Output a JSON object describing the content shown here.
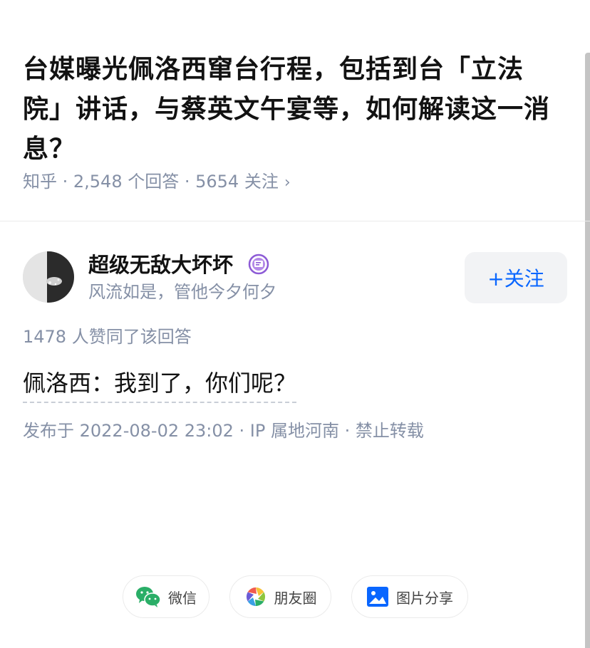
{
  "question": {
    "title": "台媒曝光佩洛西窜台行程，包括到台「立法院」讲话，与蔡英文午宴等，如何解读这一消息？",
    "source": "知乎",
    "answers_count": "2,548 个回答",
    "followers_count": "5654 关注",
    "separator": " · ",
    "chevron": "›"
  },
  "author": {
    "name": "超级无敌大坏坏",
    "bio": "风流如是，管他今夕何夕",
    "follow_label": "+关注"
  },
  "answer": {
    "votes": "1478 人赞同了该回答",
    "content": "佩洛西：我到了，你们呢？",
    "published": "发布于 2022-08-02 23:02 · IP 属地河南 · 禁止转载"
  },
  "share": {
    "wechat": "微信",
    "moments": "朋友圈",
    "image": "图片分享"
  },
  "colors": {
    "accent": "#0966ff",
    "muted": "#8590a6",
    "wechat_green": "#2aae67"
  }
}
